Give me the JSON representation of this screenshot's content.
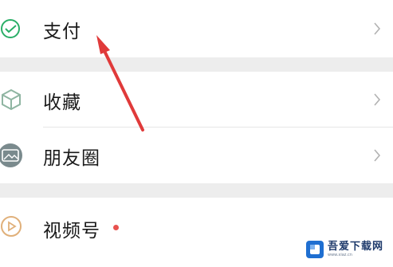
{
  "menu": {
    "items": [
      {
        "label": "支付",
        "icon": "payment-icon",
        "chevron": "chevron-right-icon"
      },
      {
        "label": "收藏",
        "icon": "favorites-cube-icon",
        "chevron": "chevron-right-icon"
      },
      {
        "label": "朋友圈",
        "icon": "moments-photo-icon",
        "chevron": "chevron-right-icon"
      },
      {
        "label": "视频号",
        "icon": "channels-play-icon",
        "badge": "red-dot"
      }
    ]
  },
  "annotation": {
    "arrow_color": "#e03a3a",
    "points_to": "支付"
  },
  "watermark": {
    "title": "吾爱下载网",
    "subtitle": "www.xiaz.cn"
  },
  "colors": {
    "background": "#ededed",
    "row": "#ffffff",
    "accent_green": "#2aae67",
    "badge_red": "#e8524f"
  }
}
